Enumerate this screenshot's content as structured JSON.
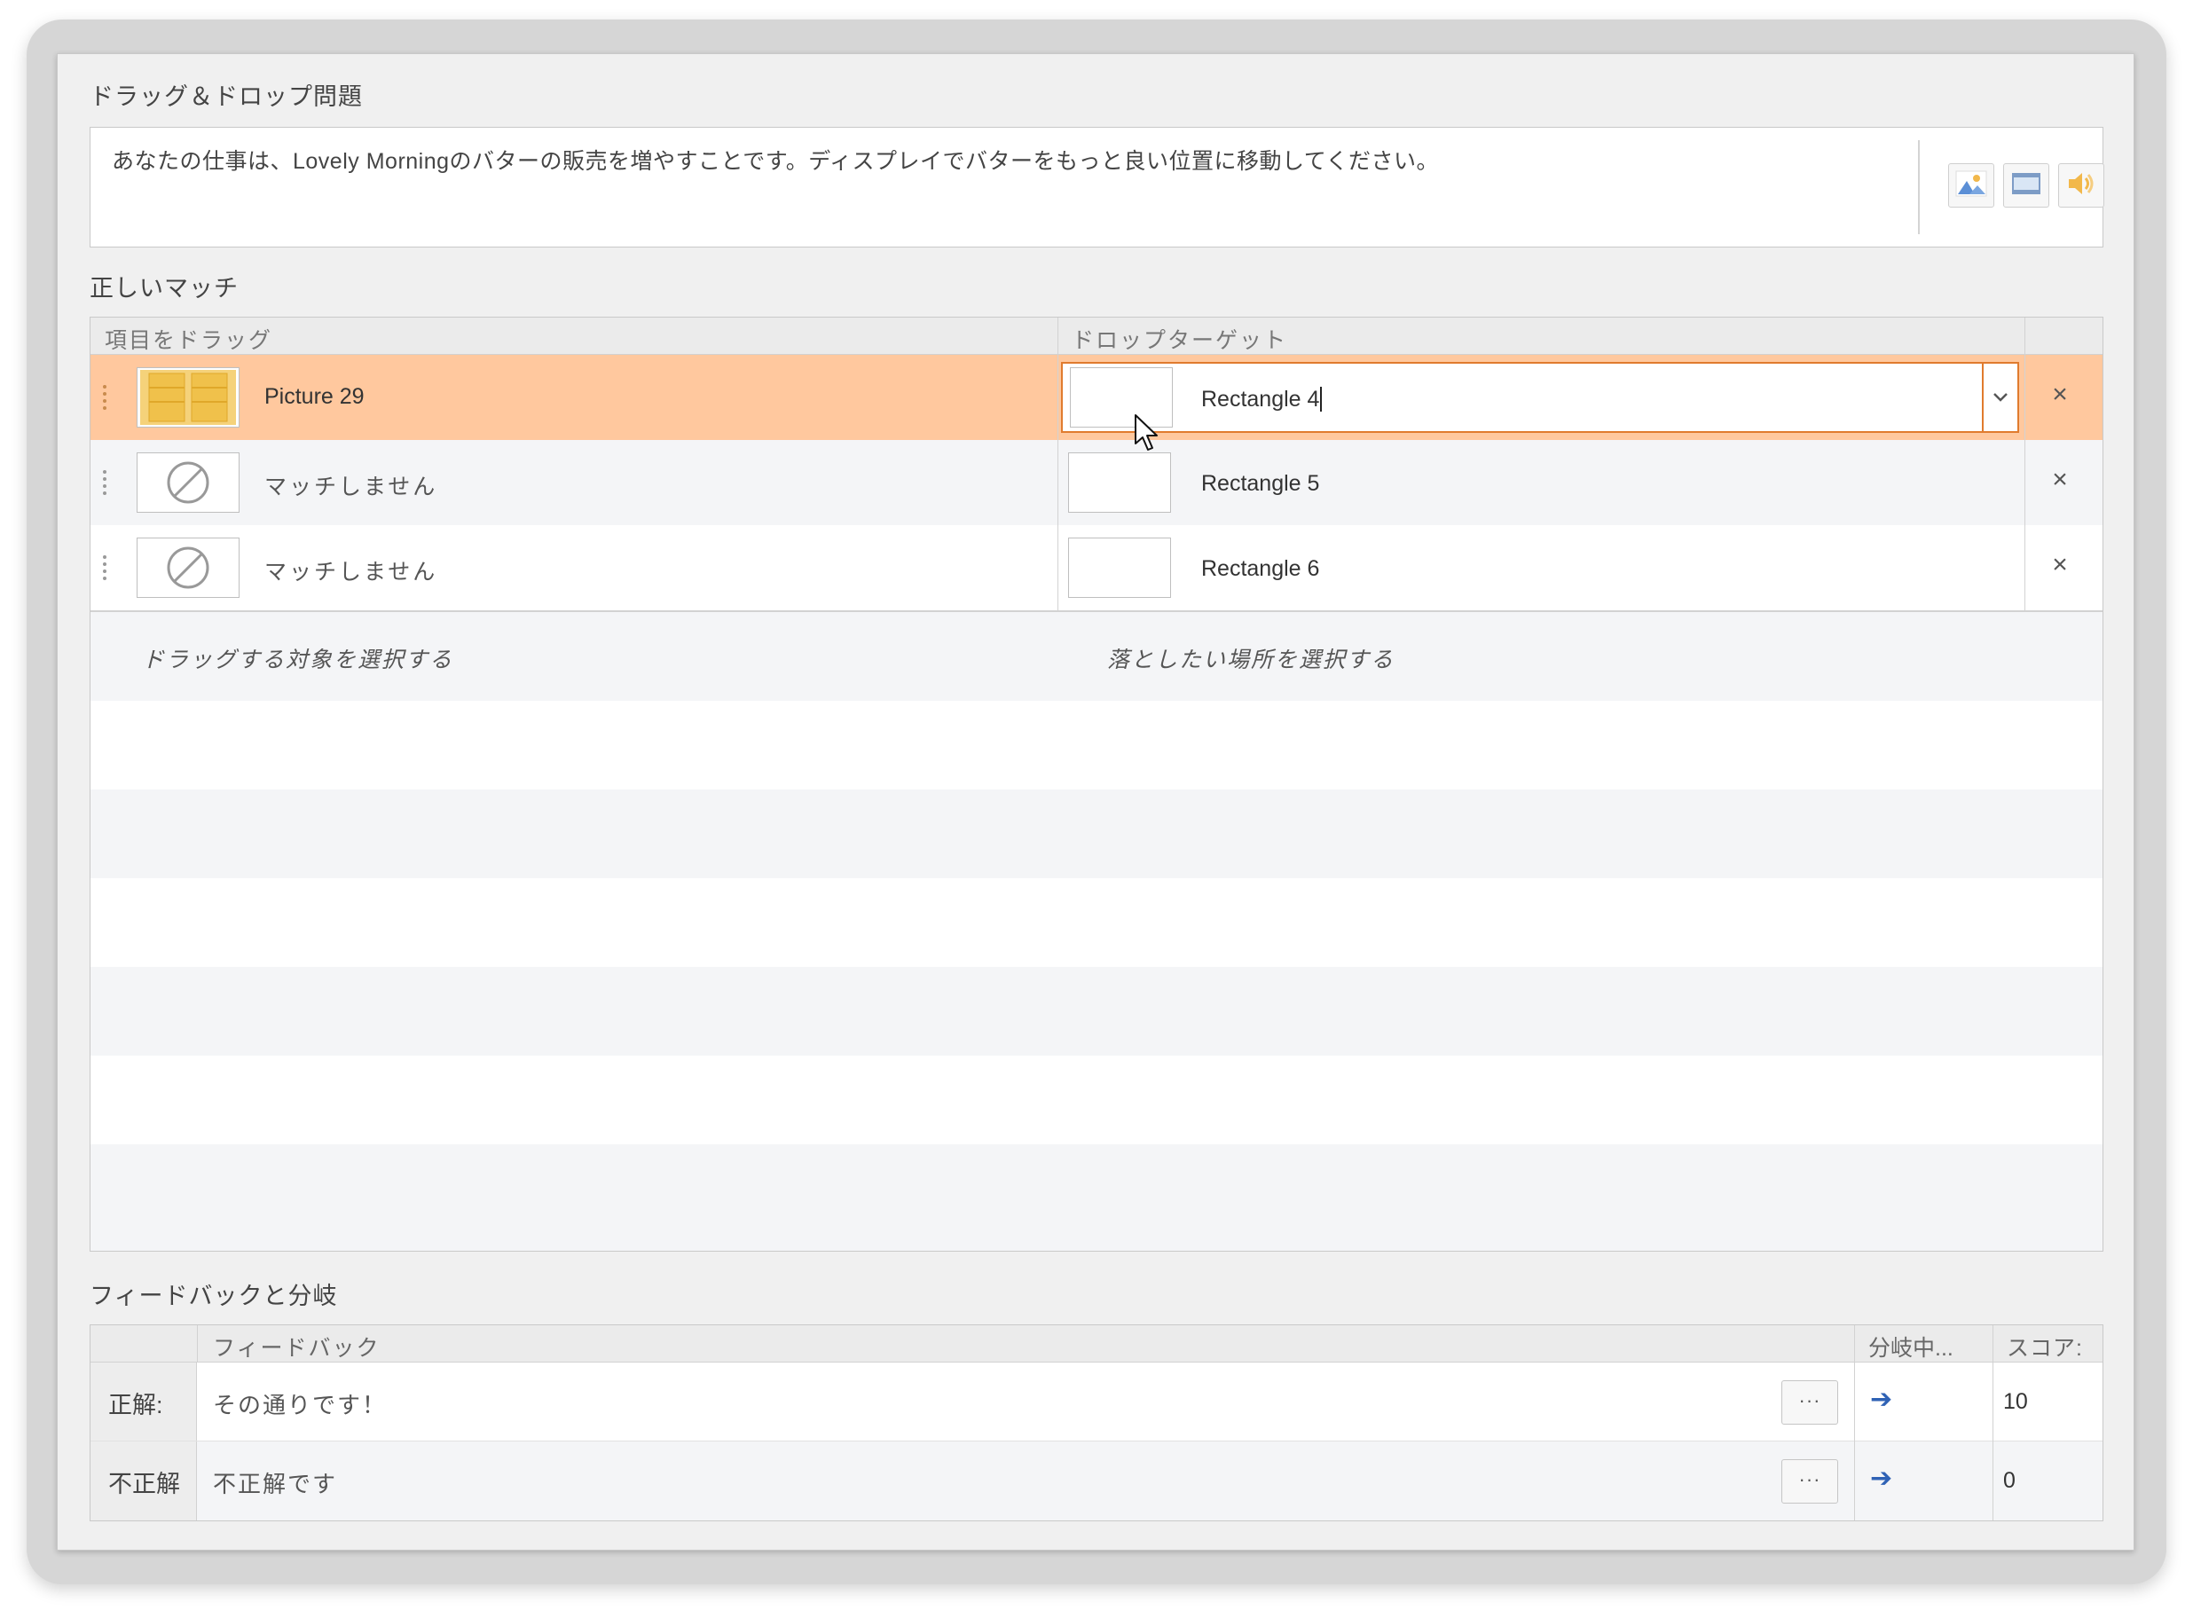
{
  "question": {
    "section_title": "ドラッグ＆ドロップ問題",
    "text": "あなたの仕事は、Lovely Morningのバターの販売を増やすことです。ディスプレイでバターをもっと良い位置に移動してください。",
    "media_buttons": [
      "image-icon",
      "video-icon",
      "audio-icon"
    ]
  },
  "matches": {
    "section_title": "正しいマッチ",
    "columns": {
      "drag": "項目をドラッグ",
      "target": "ドロップターゲット"
    },
    "rows": [
      {
        "item": "Picture 29",
        "thumb": "butter-image",
        "target": "Rectangle 4",
        "selected": true
      },
      {
        "item": "マッチしません",
        "thumb": "no-match-icon",
        "target": "Rectangle 5",
        "selected": false
      },
      {
        "item": "マッチしません",
        "thumb": "no-match-icon",
        "target": "Rectangle 6",
        "selected": false
      }
    ],
    "placeholder_drag": "ドラッグする対象を選択する",
    "placeholder_target": "落としたい場所を選択する",
    "remove_glyph": "×"
  },
  "feedback": {
    "section_title": "フィードバックと分岐",
    "columns": {
      "feedback": "フィードバック",
      "branch": "分岐中...",
      "score": "スコア:"
    },
    "rows": [
      {
        "label": "正解:",
        "text": "その通りです！",
        "more": "···",
        "score": "10"
      },
      {
        "label": "不正解",
        "text": "不正解です",
        "more": "···",
        "score": "0"
      }
    ]
  },
  "colors": {
    "selected_row": "#ffc89e",
    "accent_orange": "#e07b2e",
    "branch_arrow": "#2f62b5"
  }
}
